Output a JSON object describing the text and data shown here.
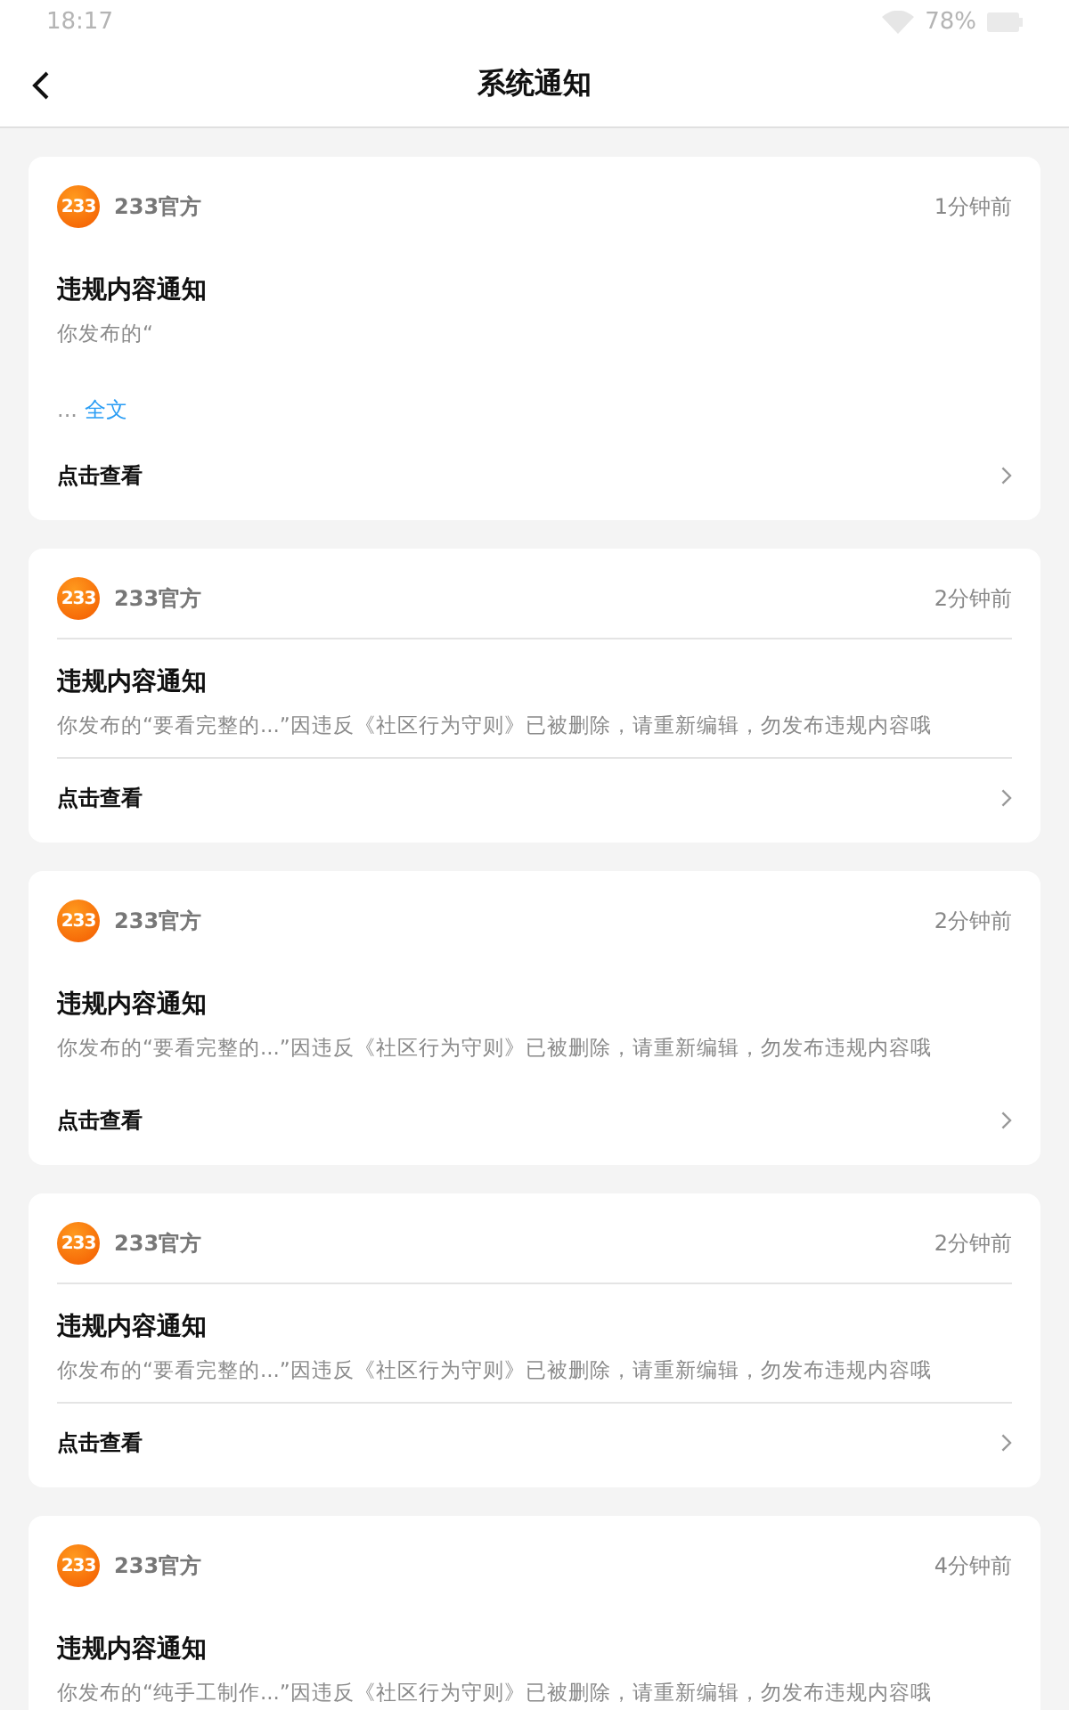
{
  "status_bar": {
    "time": "18:17",
    "battery": "78%"
  },
  "header": {
    "title": "系统通知"
  },
  "notifications": [
    {
      "logo": "233",
      "sender": "233官方",
      "time": "1分钟前",
      "dividers": false,
      "title": "违规内容通知",
      "body": "你发布的“",
      "more": {
        "ellipsis": "...",
        "link": "全文"
      },
      "action": "点击查看"
    },
    {
      "logo": "233",
      "sender": "233官方",
      "time": "2分钟前",
      "dividers": true,
      "title": "违规内容通知",
      "body": "你发布的“要看完整的...”因违反《社区行为守则》已被删除，请重新编辑，勿发布违规内容哦",
      "action": "点击查看"
    },
    {
      "logo": "233",
      "sender": "233官方",
      "time": "2分钟前",
      "dividers": false,
      "title": "违规内容通知",
      "body": "你发布的“要看完整的...”因违反《社区行为守则》已被删除，请重新编辑，勿发布违规内容哦",
      "action": "点击查看"
    },
    {
      "logo": "233",
      "sender": "233官方",
      "time": "2分钟前",
      "dividers": true,
      "title": "违规内容通知",
      "body": "你发布的“要看完整的...”因违反《社区行为守则》已被删除，请重新编辑，勿发布违规内容哦",
      "action": "点击查看"
    },
    {
      "logo": "233",
      "sender": "233官方",
      "time": "4分钟前",
      "dividers": false,
      "title": "违规内容通知",
      "body": "你发布的“纯手工制作...”因违反《社区行为守则》已被删除，请重新编辑，勿发布违规内容哦"
    }
  ]
}
